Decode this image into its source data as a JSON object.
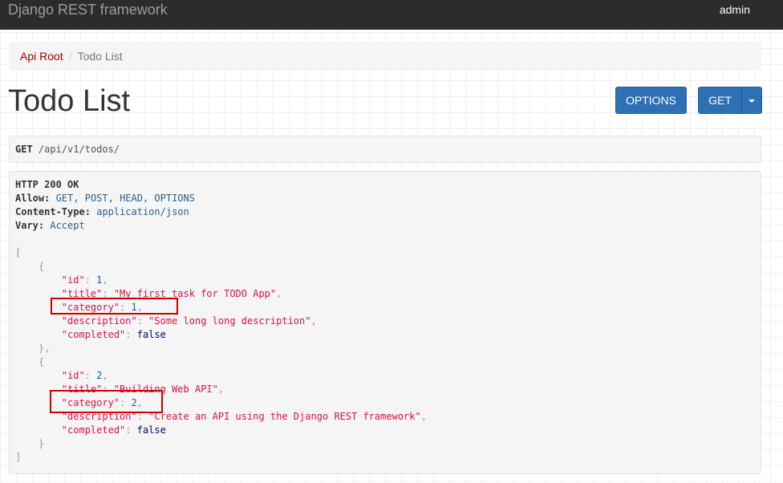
{
  "navbar": {
    "brand": "Django REST framework",
    "user": "admin"
  },
  "breadcrumb": {
    "root": "Api Root",
    "separator": "/",
    "current": "Todo List"
  },
  "page": {
    "title": "Todo List"
  },
  "buttons": {
    "options": "OPTIONS",
    "get": "GET"
  },
  "request": {
    "method": "GET",
    "path": "/api/v1/todos/"
  },
  "response": {
    "status": "HTTP 200 OK",
    "headers": [
      {
        "name": "Allow:",
        "value": "GET, POST, HEAD, OPTIONS"
      },
      {
        "name": "Content-Type:",
        "value": "application/json"
      },
      {
        "name": "Vary:",
        "value": "Accept"
      }
    ],
    "items": [
      {
        "id": "1",
        "title": "\"My first task for TODO App\"",
        "category": "1",
        "description": "\"Some long long description\"",
        "completed": "false"
      },
      {
        "id": "2",
        "title": "\"Building Web API\"",
        "category": "2",
        "description": "\"Create an API using the Django REST framework\"",
        "completed": "false"
      }
    ]
  },
  "keys": {
    "id": "\"id\"",
    "title": "\"title\"",
    "category": "\"category\"",
    "description": "\"description\"",
    "completed": "\"completed\""
  },
  "colors": {
    "navbar": "#2c2c2c",
    "primary_button": "#2f6fb4",
    "link": "#a30000",
    "annotation": "#cc0000"
  }
}
